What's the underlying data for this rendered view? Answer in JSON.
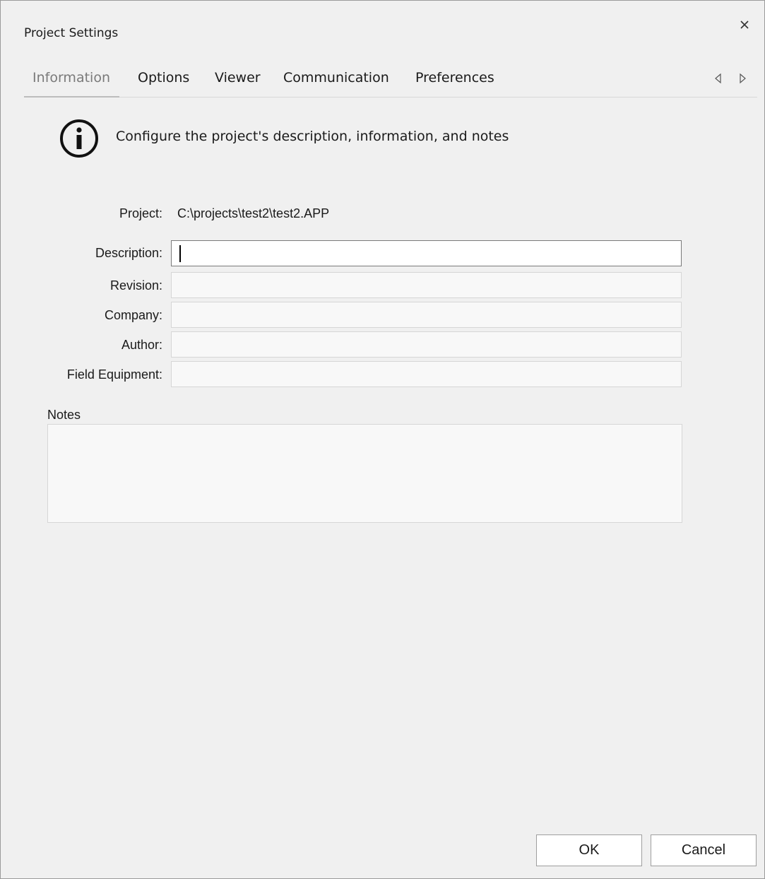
{
  "window": {
    "title": "Project Settings"
  },
  "tabs": [
    {
      "label": "Information",
      "active": true
    },
    {
      "label": "Options",
      "active": false
    },
    {
      "label": "Viewer",
      "active": false
    },
    {
      "label": "Communication",
      "active": false
    },
    {
      "label": "Preferences",
      "active": false
    }
  ],
  "info": {
    "icon": "info-icon",
    "heading": "Configure the project's description, information, and notes"
  },
  "form": {
    "project_label": "Project:",
    "project_value": "C:\\projects\\test2\\test2.APP",
    "fields": [
      {
        "label": "Description:",
        "value": "",
        "focused": true
      },
      {
        "label": "Revision:",
        "value": ""
      },
      {
        "label": "Company:",
        "value": ""
      },
      {
        "label": "Author:",
        "value": ""
      },
      {
        "label": "Field Equipment:",
        "value": ""
      }
    ],
    "notes_label": "Notes",
    "notes_value": ""
  },
  "buttons": {
    "ok": "OK",
    "cancel": "Cancel"
  },
  "colors": {
    "background": "#f0f0f0",
    "field_background": "#f8f8f8",
    "inactive_tab_text": "#7a7a7a"
  }
}
